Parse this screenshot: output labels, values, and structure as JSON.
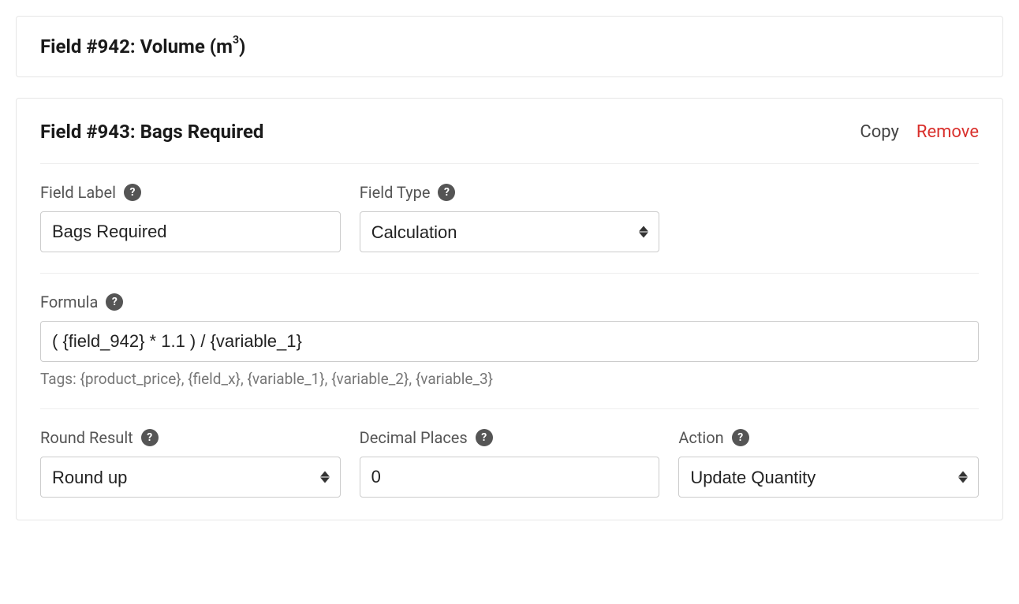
{
  "field942": {
    "title_prefix": "Field #942: Volume (m",
    "title_sup": "3",
    "title_suffix": ")"
  },
  "field943": {
    "title": "Field #943: Bags Required",
    "actions": {
      "copy": "Copy",
      "remove": "Remove"
    },
    "fieldLabel": {
      "label": "Field Label",
      "value": "Bags Required"
    },
    "fieldType": {
      "label": "Field Type",
      "value": "Calculation"
    },
    "formula": {
      "label": "Formula",
      "value": "( {field_942} * 1.1 ) / {variable_1}",
      "hint": "Tags: {product_price}, {field_x}, {variable_1}, {variable_2}, {variable_3}"
    },
    "roundResult": {
      "label": "Round Result",
      "value": "Round up"
    },
    "decimalPlaces": {
      "label": "Decimal Places",
      "value": "0"
    },
    "action": {
      "label": "Action",
      "value": "Update Quantity"
    }
  }
}
